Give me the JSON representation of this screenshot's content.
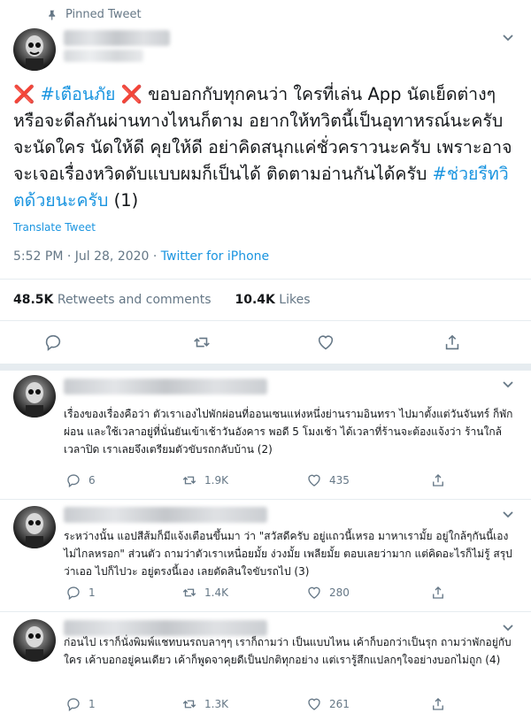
{
  "pinned": {
    "label": "Pinned Tweet"
  },
  "tweet": {
    "text_parts": {
      "x1": "❌",
      "tag1": "#เตือนภัย",
      "x2": "❌",
      "body": " ขอบอกกับทุกคนว่า ใครที่เล่น App นัดเย็ดต่างๆ หรือจะดีลกันผ่านทางไหนก็ตาม อยากให้ทวิตนี้เป็นอุทาหรณ์นะครับ จะนัดใคร นัดให้ดี คุยให้ดี อย่าคิดสนุกแค่ชั่วคราวนะครับ เพราะอาจจะเจอเรื่องหวิดดับแบบผมก็เป็นได้ ติดตามอ่านกันได้ครับ ",
      "tag2": "#ช่วยรีทวิตด้วยนะครับ",
      "suffix": " (1)"
    },
    "translate": "Translate Tweet",
    "time": "5:52 PM · Jul 28, 2020 · ",
    "source": "Twitter for iPhone",
    "stats": {
      "retweets_count": "48.5K",
      "retweets_label": " Retweets and comments",
      "likes_count": "10.4K",
      "likes_label": " Likes"
    }
  },
  "replies": [
    {
      "text": "เรื่องของเรื่องคือว่า ตัวเราเองไปพักผ่อนที่ออนเซนแห่งหนึ่งย่านรามอินทรา ไปมาตั้งแต่วันจันทร์ ก็พักผ่อน และใช้เวลาอยู่ที่นั่นยันเข้าเช้าวันอังคาร พอดี 5 โมงเช้า ได้เวลาที่ร้านจะต้องแจ้งว่า ร้านใกล้เวลาปิด เราเลยจึงเตรียมตัวขับรถกลับบ้าน (2)",
      "replies": "6",
      "retweets": "1.9K",
      "likes": "435"
    },
    {
      "text": "ระหว่างนั้น แอปสีส้มก็มีแจ้งเตือนขึ้นมา ว่า \"สวัสดีครับ อยู่แถวนี้เหรอ มาหาเรามั้ย อยู่ใกล้ๆกันนี้เอง ไม่ไกลหรอก\" ส่วนตัว ถามว่าตัวเราเหนื่อยมั้ย ง่วงมั้ย เพลียมั้ย ตอบเลยว่ามาก แต่คิดอะไรก็ไม่รู้ สรุปว่าเออ ไปก็ไปวะ อยู่ตรงนี้เอง เลยตัดสินใจขับรถไป (3)",
      "replies": "1",
      "retweets": "1.4K",
      "likes": "280"
    },
    {
      "text": "ก่อนไป เราก็นั่งพิมพ์แชทบนรถบลาๆๆ เราก็ถามว่า เป็นแบบไหน เค้าก็บอกว่าเป็นรุก ถามว่าพักอยู่กับใคร เค้าบอกอยู่คนเดียว เค้าก็พูดจาคุยดีเป็นปกติทุกอย่าง แต่เรารู้สึกแปลกๆใจอย่างบอกไม่ถูก (4)",
      "replies": "1",
      "retweets": "1.3K",
      "likes": "261"
    }
  ],
  "colors": {
    "link": "#1b95e0",
    "muted": "#657786",
    "text": "#14171a",
    "divider": "#e6ecf0",
    "x_mark": "#e0245e"
  }
}
